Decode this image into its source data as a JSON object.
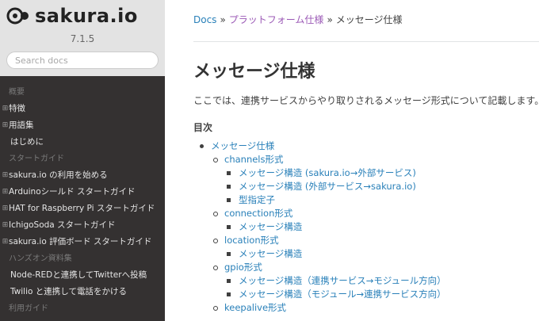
{
  "brand": {
    "name": "sakura.io",
    "version": "7.1.5"
  },
  "search": {
    "placeholder": "Search docs"
  },
  "nav": [
    {
      "type": "caption",
      "label": "概要"
    },
    {
      "type": "item",
      "label": "特徴",
      "toggle": true
    },
    {
      "type": "item",
      "label": "用語集",
      "toggle": true
    },
    {
      "type": "item",
      "label": "はじめに",
      "toggle": false
    },
    {
      "type": "caption",
      "label": "スタートガイド"
    },
    {
      "type": "item",
      "label": "sakura.io の利用を始める",
      "toggle": true
    },
    {
      "type": "item",
      "label": "Arduinoシールド スタートガイド",
      "toggle": true
    },
    {
      "type": "item",
      "label": "HAT for Raspberry Pi スタートガイド",
      "toggle": true
    },
    {
      "type": "item",
      "label": "IchigoSoda スタートガイド",
      "toggle": true
    },
    {
      "type": "item",
      "label": "sakura.io 評価ボード スタートガイド",
      "toggle": true
    },
    {
      "type": "caption",
      "label": "ハンズオン資料集"
    },
    {
      "type": "item",
      "label": "Node-REDと連携してTwitterへ投稿",
      "toggle": false
    },
    {
      "type": "item",
      "label": "Twilio と連携して電話をかける",
      "toggle": false
    },
    {
      "type": "caption",
      "label": "利用ガイド"
    }
  ],
  "breadcrumb": {
    "home": "Docs",
    "sep": "»",
    "parent": "プラットフォーム仕様",
    "current": "メッセージ仕様"
  },
  "page": {
    "title": "メッセージ仕様",
    "intro": "ここでは、連携サービスからやり取りされるメッセージ形式について記載します。",
    "toc_title": "目次"
  },
  "toc": [
    {
      "level": 1,
      "label": "メッセージ仕様"
    },
    {
      "level": 2,
      "label": "channels形式"
    },
    {
      "level": 3,
      "label": "メッセージ構造 (sakura.io→外部サービス)"
    },
    {
      "level": 3,
      "label": "メッセージ構造 (外部サービス→sakura.io)"
    },
    {
      "level": 3,
      "label": "型指定子"
    },
    {
      "level": 2,
      "label": "connection形式"
    },
    {
      "level": 3,
      "label": "メッセージ構造"
    },
    {
      "level": 2,
      "label": "location形式"
    },
    {
      "level": 3,
      "label": "メッセージ構造"
    },
    {
      "level": 2,
      "label": "gpio形式"
    },
    {
      "level": 3,
      "label": "メッセージ構造（連携サービス→モジュール方向）"
    },
    {
      "level": 3,
      "label": "メッセージ構造（モジュール→連携サービス方向）"
    },
    {
      "level": 2,
      "label": "keepalive形式"
    }
  ]
}
